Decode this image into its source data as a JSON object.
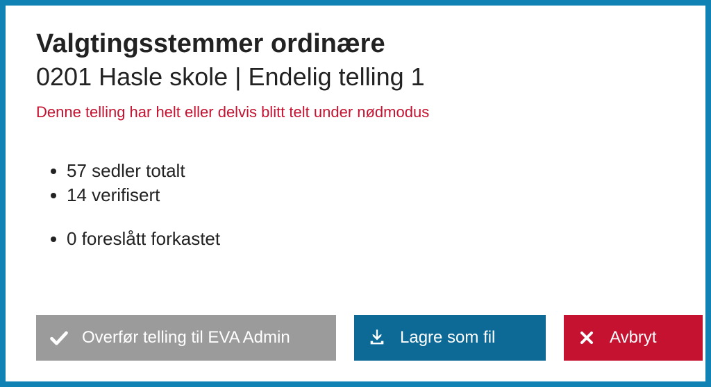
{
  "header": {
    "title": "Valgtingsstemmer ordinære",
    "subtitle": "0201 Hasle skole | Endelig telling 1"
  },
  "warning": "Denne telling har helt eller delvis blitt telt under nødmodus",
  "stats": {
    "total": "57 sedler totalt",
    "verified": "14 verifisert",
    "proposed_rejected": "0 foreslått forkastet"
  },
  "buttons": {
    "transfer": "Overfør telling til EVA Admin",
    "save": "Lagre som fil",
    "cancel": "Avbryt"
  }
}
